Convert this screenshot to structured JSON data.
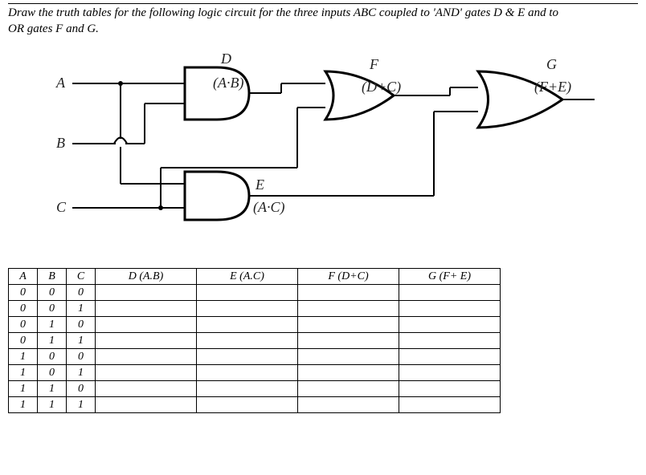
{
  "question": {
    "line1": "Draw the truth tables for the following logic circuit for the three inputs ABC coupled to 'AND' gates D & E and to",
    "line2": "OR gates F and G."
  },
  "circuit": {
    "inputs": {
      "A": "A",
      "B": "B",
      "C": "C"
    },
    "gates": {
      "D": {
        "label": "D",
        "expr": "(A·B)"
      },
      "E": {
        "label": "E",
        "expr": "(A·C)"
      },
      "F": {
        "label": "F",
        "expr": "(D+C)"
      },
      "G": {
        "label": "G",
        "expr": "(F+E)"
      }
    }
  },
  "table": {
    "headers": [
      "A",
      "B",
      "C",
      "D (A.B)",
      "E (A.C)",
      "F (D+C)",
      "G (F+ E)"
    ],
    "rows": [
      [
        "0",
        "0",
        "0",
        "",
        "",
        "",
        ""
      ],
      [
        "0",
        "0",
        "1",
        "",
        "",
        "",
        ""
      ],
      [
        "0",
        "1",
        "0",
        "",
        "",
        "",
        ""
      ],
      [
        "0",
        "1",
        "1",
        "",
        "",
        "",
        ""
      ],
      [
        "1",
        "0",
        "0",
        "",
        "",
        "",
        ""
      ],
      [
        "1",
        "0",
        "1",
        "",
        "",
        "",
        ""
      ],
      [
        "1",
        "1",
        "0",
        "",
        "",
        "",
        ""
      ],
      [
        "1",
        "1",
        "1",
        "",
        "",
        "",
        ""
      ]
    ]
  }
}
